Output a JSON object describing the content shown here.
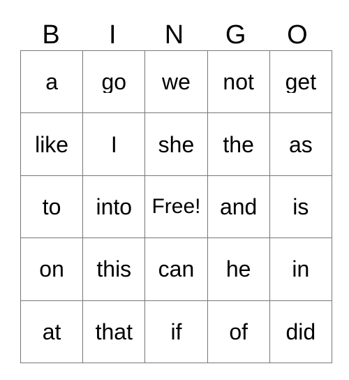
{
  "card": {
    "title_letters": [
      "B",
      "I",
      "N",
      "G",
      "O"
    ],
    "columns": 5,
    "rows": 5,
    "free_space_label": "Free!",
    "free_space_position": {
      "row": 3,
      "column": 3
    },
    "colors": {
      "background": "#ffffff",
      "text": "#000000",
      "grid_line": "#777777"
    },
    "grid": [
      {
        "cells": [
          "a",
          "go",
          "we",
          "not",
          "get"
        ]
      },
      {
        "cells": [
          "like",
          "I",
          "she",
          "the",
          "as"
        ]
      },
      {
        "cells": [
          "to",
          "into",
          "Free!",
          "and",
          "is"
        ]
      },
      {
        "cells": [
          "on",
          "this",
          "can",
          "he",
          "in"
        ]
      },
      {
        "cells": [
          "at",
          "that",
          "if",
          "of",
          "did"
        ]
      }
    ]
  }
}
